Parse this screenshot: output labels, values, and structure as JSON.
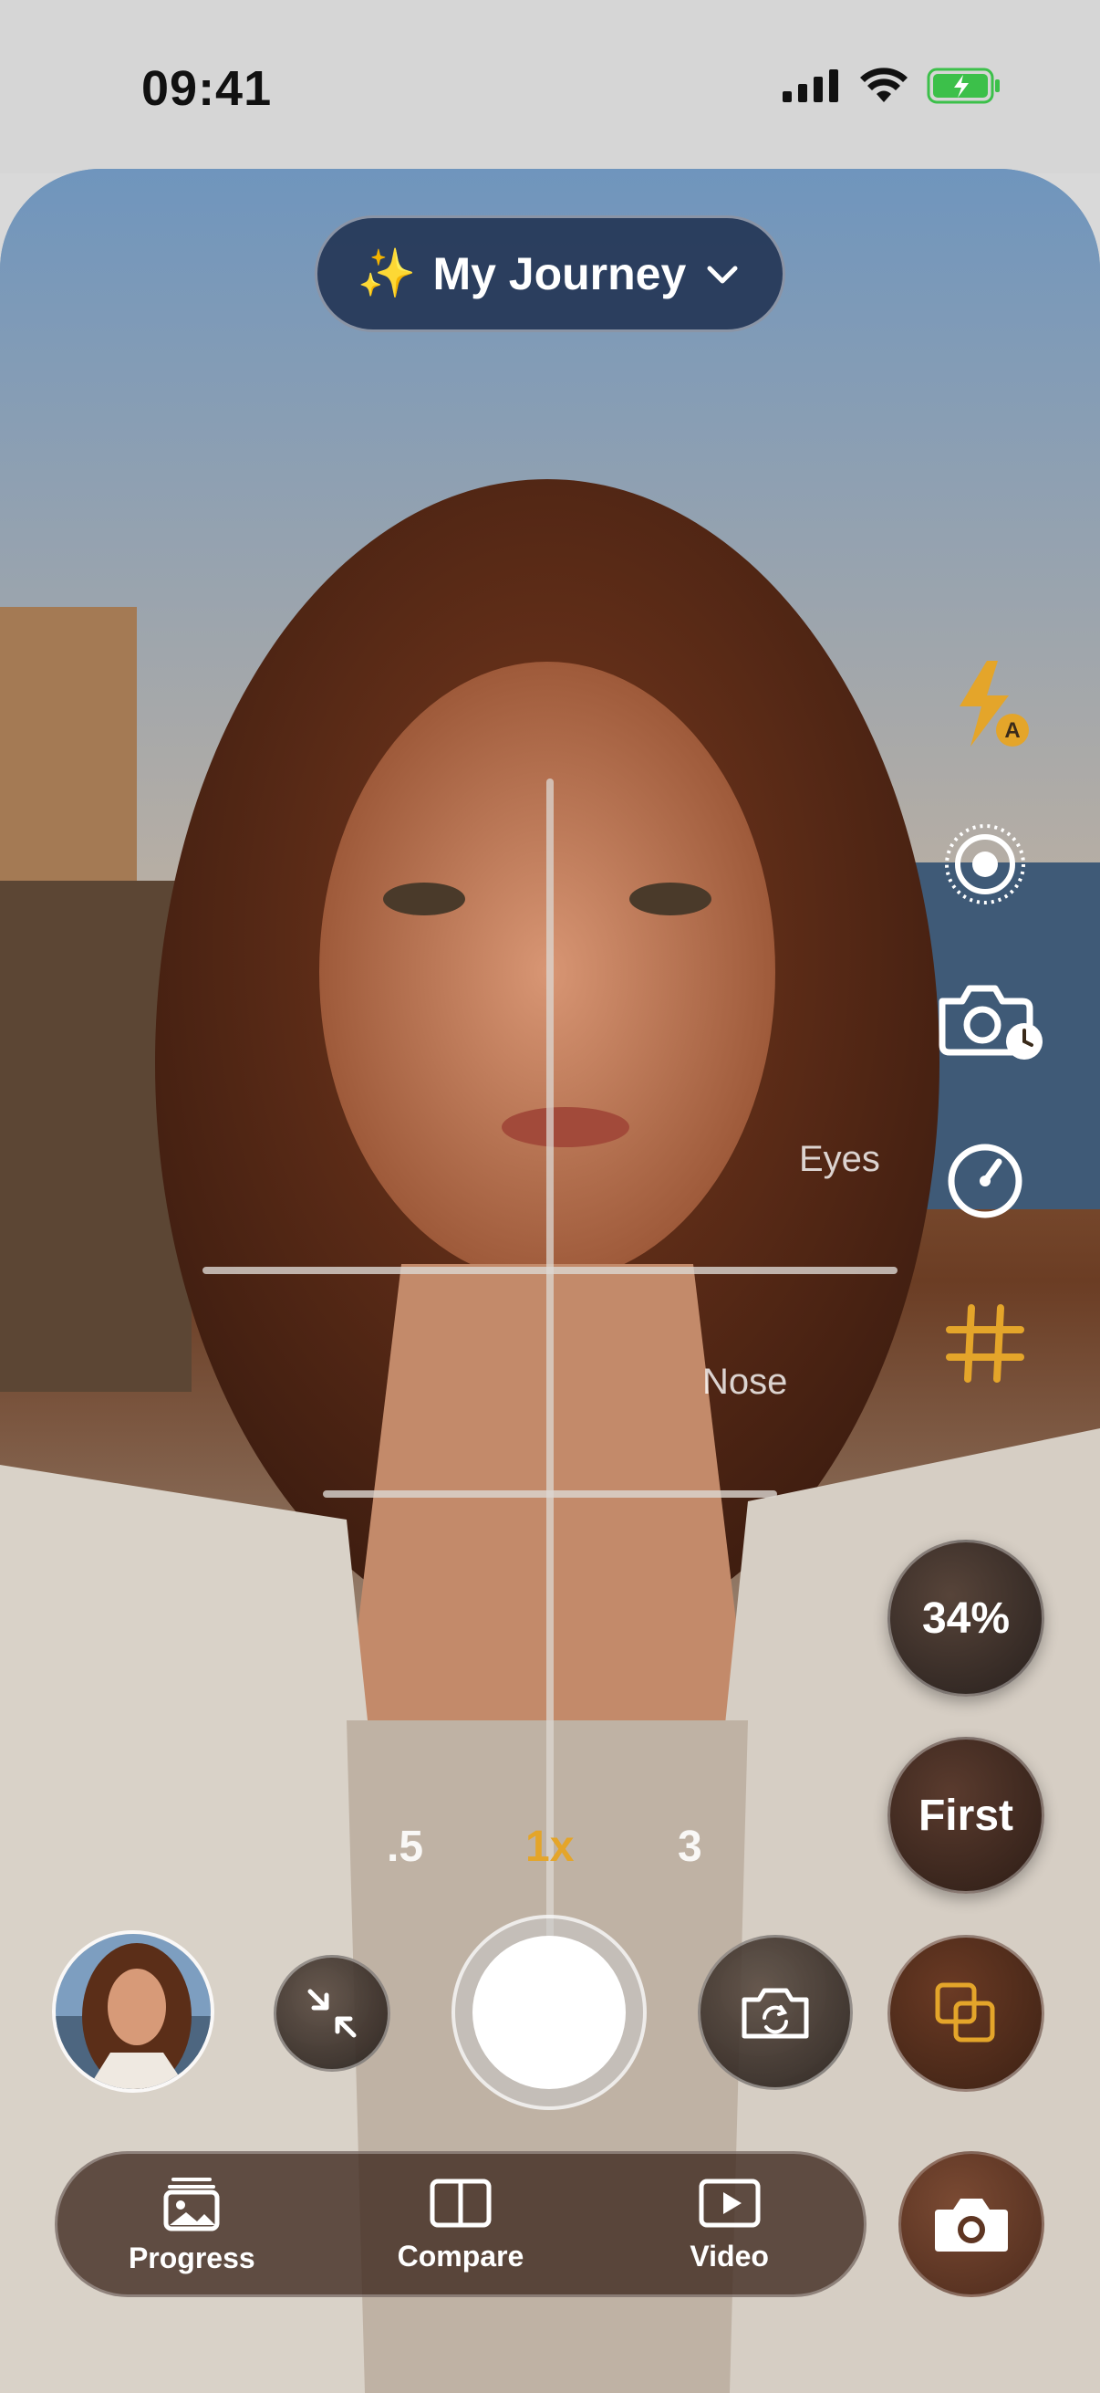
{
  "status_bar": {
    "time": "09:41"
  },
  "journey": {
    "label": "My Journey",
    "sparkle": "✨"
  },
  "guides": {
    "eyes_label": "Eyes",
    "nose_label": "Nose"
  },
  "tools": {
    "flash": "flash-auto-icon",
    "live": "live-photo-icon",
    "timer_capture": "camera-timer-icon",
    "speed": "speedometer-icon",
    "grid": "grid-icon"
  },
  "overlay": {
    "opacity_label": "34%",
    "first_label": "First"
  },
  "zoom": {
    "options": [
      ".5",
      "1x",
      "3"
    ],
    "selected": "1x"
  },
  "tabs": [
    {
      "label": "Progress",
      "icon": "photo-stack-icon"
    },
    {
      "label": "Compare",
      "icon": "split-view-icon"
    },
    {
      "label": "Video",
      "icon": "play-rectangle-icon"
    }
  ],
  "colors": {
    "accent": "#e4a52a",
    "pill": "#223454",
    "fab": "#5e3522"
  }
}
